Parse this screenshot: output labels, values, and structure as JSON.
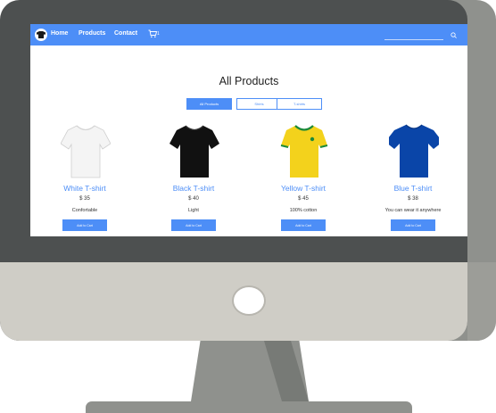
{
  "nav": {
    "logo_icon": "tshirt-logo-icon",
    "links": [
      "Home",
      "Products",
      "Contact"
    ],
    "cart_icon": "cart-icon",
    "cart_count": "1",
    "search_placeholder": "",
    "search_icon": "search-icon"
  },
  "page": {
    "title": "All Products",
    "filters": [
      "All Products",
      "Shirts",
      "T-shirts"
    ],
    "active_filter": "All Products"
  },
  "products": [
    {
      "name": "White T-shirt",
      "price": "$ 35",
      "description": "Confortable",
      "button": "Add to Cart",
      "color": "#f4f4f4"
    },
    {
      "name": "Black T-shirt",
      "price": "$ 40",
      "description": "Light",
      "button": "Add to Cart",
      "color": "#111111"
    },
    {
      "name": "Yellow T-shirt",
      "price": "$ 45",
      "description": "100% cotton",
      "button": "Add to Cart",
      "color": "#f3d21c"
    },
    {
      "name": "Blue T-shirt",
      "price": "$ 38",
      "description": "You can wear it anywhere",
      "button": "Add to Cart",
      "color": "#0a45a8"
    }
  ],
  "colors": {
    "accent": "#4d8ef7",
    "bezel": "#4d5050",
    "chin": "#cfcdc6"
  }
}
